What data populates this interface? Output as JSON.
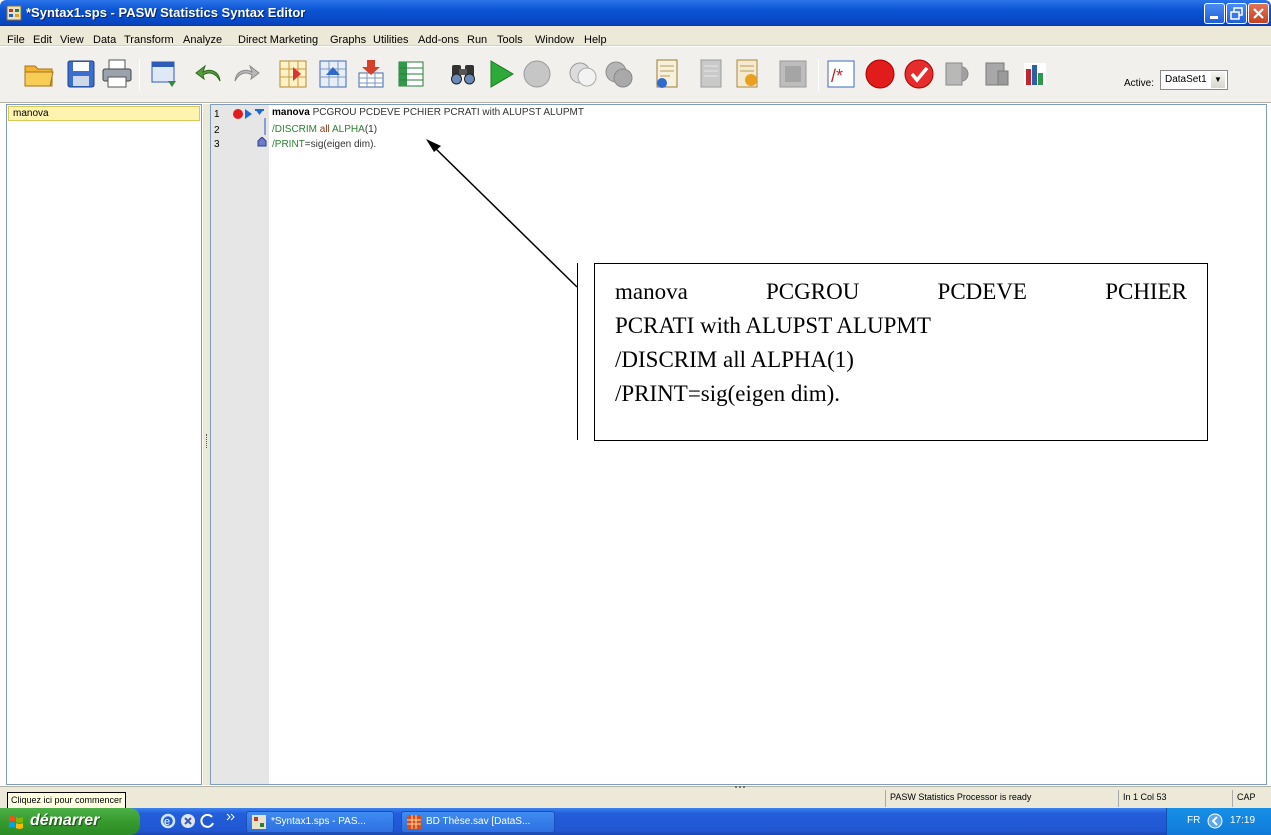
{
  "window": {
    "title": "*Syntax1.sps - PASW Statistics Syntax Editor"
  },
  "menu": [
    {
      "label": "File"
    },
    {
      "label": "Edit"
    },
    {
      "label": "View"
    },
    {
      "label": "Data"
    },
    {
      "label": "Transform"
    },
    {
      "label": "Analyze"
    },
    {
      "label": "Direct Marketing"
    },
    {
      "label": "Graphs"
    },
    {
      "label": "Utilities"
    },
    {
      "label": "Add-ons"
    },
    {
      "label": "Run"
    },
    {
      "label": "Tools"
    },
    {
      "label": "Window"
    },
    {
      "label": "Help"
    }
  ],
  "toolbar": {
    "active_label": "Active:",
    "active_dataset": "DataSet1",
    "icons": [
      "open-icon",
      "save-icon",
      "print-icon",
      "dialog-recall-icon",
      "undo-icon",
      "redo-icon",
      "goto-case-icon",
      "goto-variable-icon",
      "variables-icon",
      "value-labels-icon",
      "find-icon",
      "run-selection-icon",
      "stop-icon",
      "show-syntax-icon",
      "hide-syntax-icon",
      "goto-output-icon",
      "syntax-help-icon",
      "comment-icon",
      "uncomment-icon",
      "block-comment-icon",
      "add-breakpoint-icon",
      "validate-icon",
      "bookmark-icon",
      "next-bookmark-icon",
      "clear-bookmarks-icon",
      "chart-builder-icon"
    ]
  },
  "navigator": {
    "selected_item": "manova"
  },
  "editor": {
    "lines": [
      {
        "number": "1",
        "keyword": "manova",
        "rest": " PCGROU PCDEVE PCHIER PCRATI with ALUPST ALUPMT"
      },
      {
        "number": "2",
        "part1": "/DISCRIM",
        "part2": " all ",
        "part3": "ALPHA",
        "part4": "(1)"
      },
      {
        "number": "3",
        "part1": "/PRINT",
        "part2": "=sig(eigen dim)."
      }
    ]
  },
  "annotation": {
    "line1_words": [
      "manova",
      "PCGROU",
      "PCDEVE",
      "PCHIER"
    ],
    "line2": "PCRATI with ALUPST ALUPMT",
    "line3": "/DISCRIM all ALPHA(1)",
    "line4": "/PRINT=sig(eigen dim)."
  },
  "statusbar": {
    "tooltip": "Cliquez ici pour commencer",
    "processor": "PASW Statistics Processor is ready",
    "position": "In 1 Col 53",
    "caps": "CAP"
  },
  "taskbar": {
    "start_label": "démarrer",
    "tasks": [
      "*Syntax1.sps - PAS...",
      "BD Thèse.sav [DataS..."
    ],
    "language": "FR",
    "clock": "17:19"
  }
}
